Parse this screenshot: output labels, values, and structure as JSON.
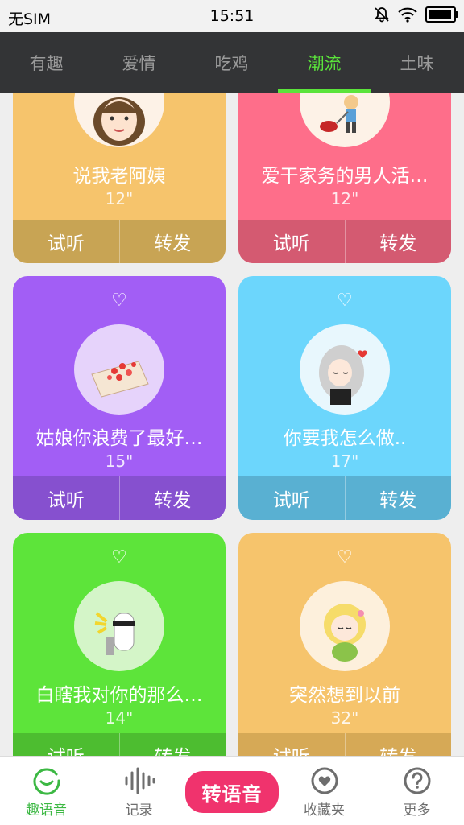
{
  "status": {
    "carrier": "无SIM",
    "time": "15:51"
  },
  "tabs": [
    {
      "label": "有趣",
      "active": false
    },
    {
      "label": "爱情",
      "active": false
    },
    {
      "label": "吃鸡",
      "active": false
    },
    {
      "label": "潮流",
      "active": true
    },
    {
      "label": "土味",
      "active": false
    }
  ],
  "cards": [
    {
      "title": "说我老阿姨",
      "duration": "12\"",
      "listen": "试听",
      "share": "转发",
      "color": "#f6c46c",
      "action_color": "#c8a454",
      "avatar": "woman-curly-hair-avatar"
    },
    {
      "title": "爱干家务的男人活…",
      "duration": "12\"",
      "listen": "试听",
      "share": "转发",
      "color": "#fe6e8a",
      "action_color": "#d45a71",
      "avatar": "man-vacuuming-avatar"
    },
    {
      "title": "姑娘你浪费了最好…",
      "duration": "15\"",
      "listen": "试听",
      "share": "转发",
      "color": "#a25ef5",
      "action_color": "#8650cf",
      "avatar": "love-letter-avatar"
    },
    {
      "title": "你要我怎么做..",
      "duration": "17\"",
      "listen": "试听",
      "share": "转发",
      "color": "#6cd6fc",
      "action_color": "#59b0d2",
      "avatar": "silver-hair-girl-avatar"
    },
    {
      "title": "白瞎我对你的那么…",
      "duration": "14\"",
      "listen": "试听",
      "share": "转发",
      "color": "#5de43a",
      "action_color": "#4dbd30",
      "avatar": "cool-alpaca-avatar"
    },
    {
      "title": "突然想到以前",
      "duration": "32\"",
      "listen": "试听",
      "share": "转发",
      "color": "#f6c46c",
      "action_color": "#d6a956",
      "avatar": "blonde-girl-avatar"
    }
  ],
  "bottom_nav": {
    "items": [
      {
        "label": "趣语音",
        "icon": "smile-icon",
        "active": true
      },
      {
        "label": "记录",
        "icon": "waveform-icon",
        "active": false
      },
      {
        "label": "收藏夹",
        "icon": "heart-icon",
        "active": false
      },
      {
        "label": "更多",
        "icon": "question-icon",
        "active": false
      }
    ],
    "convert_label": "转语音",
    "active_color": "#3cb843",
    "convert_color": "#f0336d"
  }
}
